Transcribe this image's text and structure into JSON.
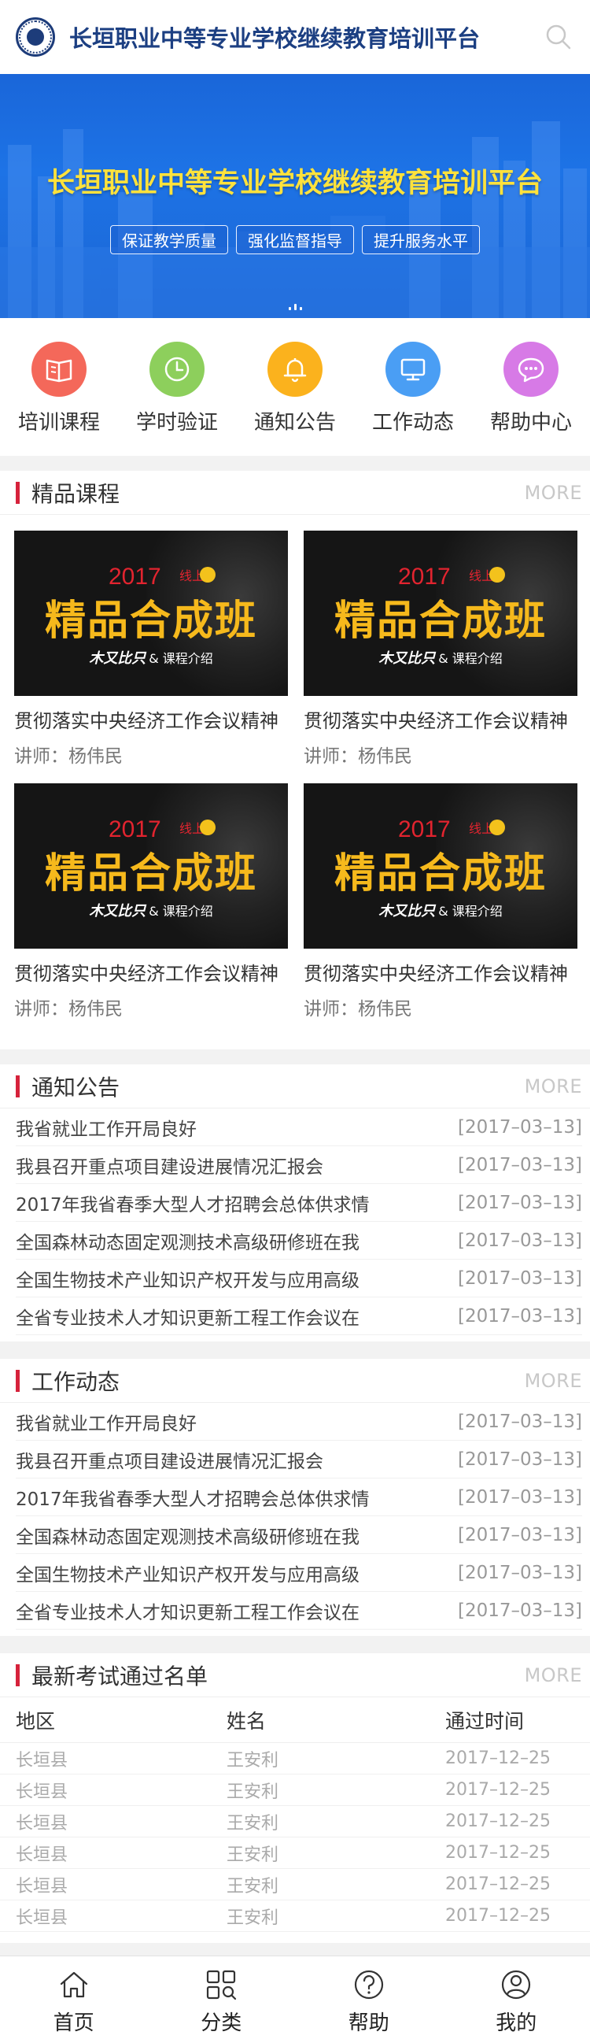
{
  "header": {
    "title": "长垣职业中等专业学校继续教育培训平台",
    "search_icon": "search-icon"
  },
  "banner": {
    "title": "长垣职业中等专业学校继续教育培训平台",
    "tags": [
      "保证教学质量",
      "强化监督指导",
      "提升服务水平"
    ]
  },
  "nav": {
    "items": [
      {
        "label": "培训课程",
        "icon": "book-icon",
        "color": "#f4685a"
      },
      {
        "label": "学时验证",
        "icon": "clock-icon",
        "color": "#8dcf5c"
      },
      {
        "label": "通知公告",
        "icon": "bell-icon",
        "color": "#fbb21d"
      },
      {
        "label": "工作动态",
        "icon": "monitor-icon",
        "color": "#4a9ef4"
      },
      {
        "label": "帮助中心",
        "icon": "chat-icon",
        "color": "#d77ae6"
      }
    ]
  },
  "courses": {
    "title": "精品课程",
    "more": "MORE",
    "thumb": {
      "year": "2017",
      "year_suffix": "线上",
      "main": "精品合成班",
      "sub_brand": "木又比只",
      "sub": "& 课程介绍"
    },
    "items": [
      {
        "name": "贯彻落实中央经济工作会议精神",
        "teacher": "讲师：杨伟民"
      },
      {
        "name": "贯彻落实中央经济工作会议精神",
        "teacher": "讲师：杨伟民"
      },
      {
        "name": "贯彻落实中央经济工作会议精神",
        "teacher": "讲师：杨伟民"
      },
      {
        "name": "贯彻落实中央经济工作会议精神",
        "teacher": "讲师：杨伟民"
      }
    ]
  },
  "notices": {
    "title": "通知公告",
    "more": "MORE",
    "items": [
      {
        "title": "我省就业工作开局良好",
        "date": "[2017–03–13]"
      },
      {
        "title": "我县召开重点项目建设进展情况汇报会",
        "date": "[2017–03–13]"
      },
      {
        "title": "2017年我省春季大型人才招聘会总体供求情",
        "date": "[2017–03–13]"
      },
      {
        "title": "全国森林动态固定观测技术高级研修班在我",
        "date": "[2017–03–13]"
      },
      {
        "title": "全国生物技术产业知识产权开发与应用高级",
        "date": "[2017–03–13]"
      },
      {
        "title": "全省专业技术人才知识更新工程工作会议在",
        "date": "[2017–03–13]"
      }
    ]
  },
  "work": {
    "title": "工作动态",
    "more": "MORE",
    "items": [
      {
        "title": "我省就业工作开局良好",
        "date": "[2017–03–13]"
      },
      {
        "title": "我县召开重点项目建设进展情况汇报会",
        "date": "[2017–03–13]"
      },
      {
        "title": "2017年我省春季大型人才招聘会总体供求情",
        "date": "[2017–03–13]"
      },
      {
        "title": "全国森林动态固定观测技术高级研修班在我",
        "date": "[2017–03–13]"
      },
      {
        "title": "全国生物技术产业知识产权开发与应用高级",
        "date": "[2017–03–13]"
      },
      {
        "title": "全省专业技术人才知识更新工程工作会议在",
        "date": "[2017–03–13]"
      }
    ]
  },
  "exam": {
    "title": "最新考试通过名单",
    "more": "MORE",
    "columns": [
      "地区",
      "姓名",
      "通过时间"
    ],
    "rows": [
      [
        "长垣县",
        "王安利",
        "2017–12–25"
      ],
      [
        "长垣县",
        "王安利",
        "2017–12–25"
      ],
      [
        "长垣县",
        "王安利",
        "2017–12–25"
      ],
      [
        "长垣县",
        "王安利",
        "2017–12–25"
      ],
      [
        "长垣县",
        "王安利",
        "2017–12–25"
      ],
      [
        "长垣县",
        "王安利",
        "2017–12–25"
      ]
    ]
  },
  "tabbar": {
    "items": [
      {
        "label": "首页",
        "icon": "home-icon"
      },
      {
        "label": "分类",
        "icon": "category-icon"
      },
      {
        "label": "帮助",
        "icon": "help-icon"
      },
      {
        "label": "我的",
        "icon": "user-icon"
      }
    ]
  },
  "colors": {
    "brand": "#1c3f82",
    "banner_blue": "#1d73e6",
    "banner_title": "#ffe23c",
    "accent_red": "#d6223b"
  }
}
